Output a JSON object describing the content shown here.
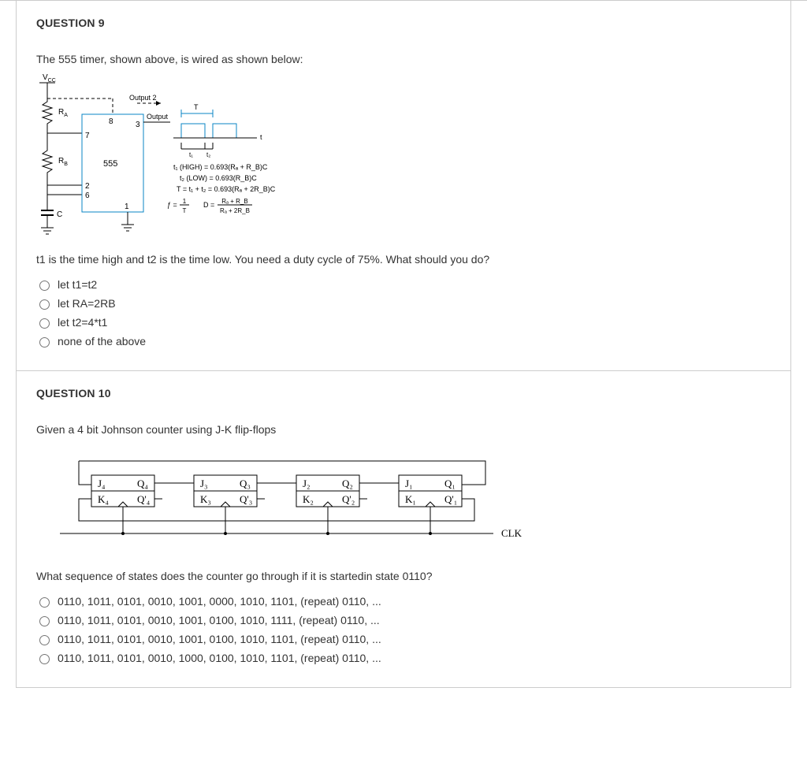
{
  "q9": {
    "title": "QUESTION 9",
    "prompt": "The 555 timer, shown above, is wired as shown below:",
    "diagram": {
      "vcc": "V",
      "vcc_sub": "CC",
      "ra": "R",
      "ra_sub": "A",
      "rb": "R",
      "rb_sub": "B",
      "c": "C",
      "chip": "555",
      "pin8": "8",
      "pin7": "7",
      "pin3": "3",
      "pin2": "2",
      "pin6": "6",
      "pin1": "1",
      "output_label": "Output",
      "output2_label": "Output 2",
      "T_label": "T",
      "t_label": "t",
      "t1_label": "t₁",
      "t2_label": "t₂",
      "eq_t1": "t₁ (HIGH) = 0.693(Rₐ + R_B)C",
      "eq_t2": "t₂ (LOW) = 0.693(R_B)C",
      "eq_T": "T = t₁ + t₂ = 0.693(Rₐ + 2R_B)C",
      "eq_f_left": "ƒ =",
      "eq_f_num": "1",
      "eq_f_den": "T",
      "eq_D_left": "D =",
      "eq_D_num": "Rₐ + R_B",
      "eq_D_den": "Rₐ + 2R_B"
    },
    "sub_prompt": "t1 is the time high and t2 is the time low. You need a duty cycle of 75%. What should you do?",
    "options": [
      "let t1=t2",
      "let RA=2RB",
      "let t2=4*t1",
      "none of the above"
    ]
  },
  "q10": {
    "title": "QUESTION 10",
    "prompt": "Given a 4 bit Johnson counter using J-K flip-flops",
    "diagram": {
      "ff": [
        {
          "J": "J₄",
          "Q": "Q₄",
          "K": "K₄",
          "Qb": "Q'₄"
        },
        {
          "J": "J₃",
          "Q": "Q₃",
          "K": "K₃",
          "Qb": "Q'₃"
        },
        {
          "J": "J₂",
          "Q": "Q₂",
          "K": "K₂",
          "Qb": "Q'₂"
        },
        {
          "J": "J₁",
          "Q": "Q₁",
          "K": "K₁",
          "Qb": "Q'₁"
        }
      ],
      "clk": "CLK"
    },
    "sub_prompt": "What sequence of states does the counter go through if it is startedin state 0110?",
    "options": [
      "0110, 1011, 0101, 0010, 1001, 0000, 1010, 1101, (repeat) 0110, ...",
      "0110, 1011, 0101, 0010, 1001, 0100, 1010, 1111, (repeat) 0110, ...",
      "0110, 1011, 0101, 0010, 1001, 0100, 1010, 1101, (repeat) 0110, ...",
      "0110, 1011, 0101, 0010, 1000, 0100, 1010, 1101, (repeat) 0110, ..."
    ]
  }
}
